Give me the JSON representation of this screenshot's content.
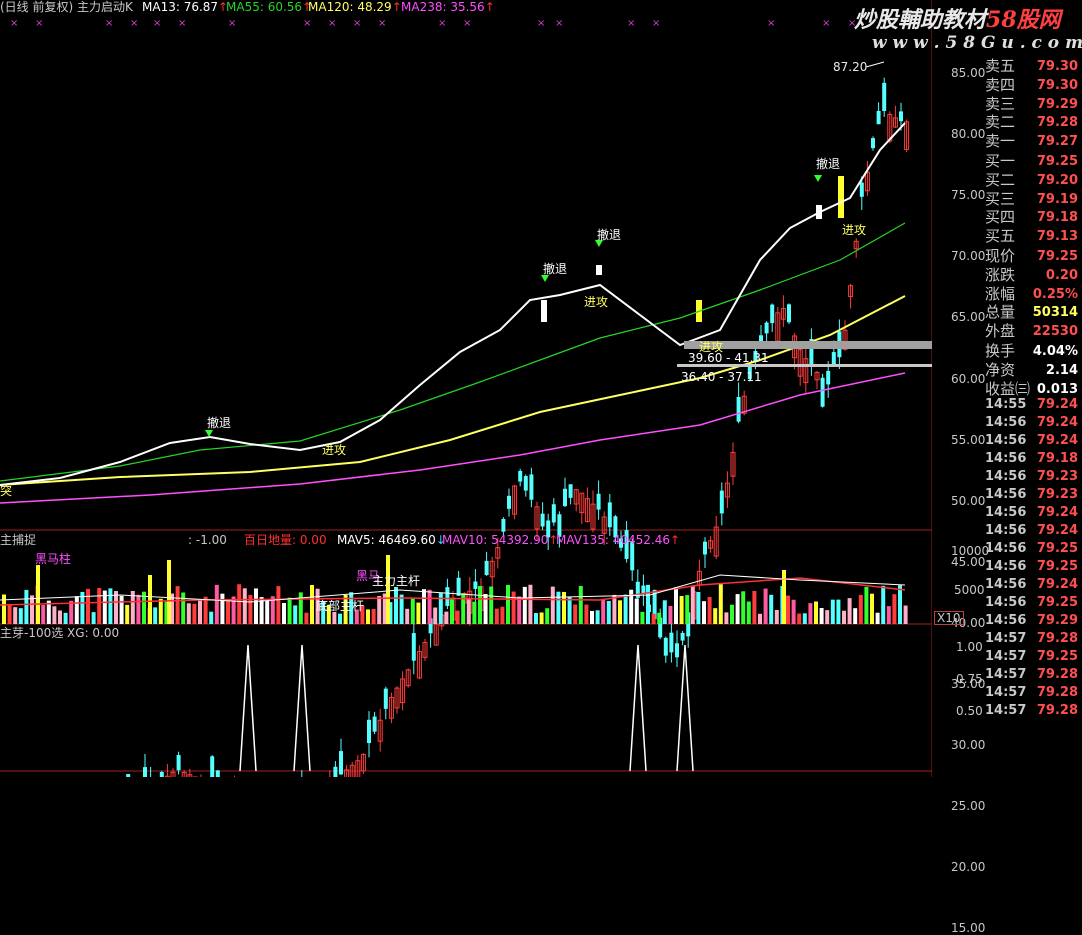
{
  "header": {
    "title": "(日线 前复权) 主力启动K",
    "ma13": {
      "label": "MA13: 76.87",
      "color": "#ffffff"
    },
    "ma55": {
      "label": "MA55: 60.56",
      "color": "#27d327"
    },
    "ma120": {
      "label": "MA120: 48.29",
      "color": "#ffff60"
    },
    "ma238": {
      "label": "MA238: 35.56",
      "color": "#ff50ff"
    },
    "arrow": "↑"
  },
  "brand": {
    "name": "炒股輔助教材",
    "site": "58股网",
    "url": "w w w . 5 8 G u . c o m"
  },
  "price_axis": [
    "85.00",
    "80.00",
    "75.00",
    "70.00",
    "65.00",
    "60.00",
    "55.00",
    "50.00",
    "45.00",
    "40.00",
    "35.00",
    "30.00",
    "25.00",
    "20.00",
    "15.00"
  ],
  "annotations": {
    "high": "87.20",
    "retreat": "撤退",
    "attack": "进攻",
    "range1": "39.60 - 41.31",
    "range2": "36.40 - 37.11",
    "left_edge": "突"
  },
  "volume_panel": {
    "title": "主捕捉",
    "v1": ": -1.00",
    "v2": "百日地量: 0.00",
    "mav5": "MAV5: 46469.60",
    "mav5_arrow": "↓",
    "mav10": "MAV10: 54392.90",
    "mav10_arrow": "↑",
    "mav135": "MAV135: 40452.46",
    "mav135_arrow": "↑",
    "tag_black_horse": "黑马柱",
    "tag_black_horse2": "黑马",
    "tag_main_force": "主力主杆",
    "tag_bottom": "底部主杆",
    "axis": [
      "10000",
      "5000"
    ],
    "unit": "X10"
  },
  "signal_panel": {
    "title": "主芽-100选  XG: 0.00",
    "axis": [
      "1.00",
      "0.75",
      "0.50"
    ]
  },
  "quote_panel": {
    "rows": [
      {
        "label": "卖五",
        "value": "79.30",
        "color": "#ff5050"
      },
      {
        "label": "卖四",
        "value": "79.30",
        "color": "#ff5050"
      },
      {
        "label": "卖三",
        "value": "79.29",
        "color": "#ff5050"
      },
      {
        "label": "卖二",
        "value": "79.28",
        "color": "#ff5050"
      },
      {
        "label": "卖一",
        "value": "79.27",
        "color": "#ff5050"
      },
      {
        "label": "买一",
        "value": "79.25",
        "color": "#ff5050"
      },
      {
        "label": "买二",
        "value": "79.20",
        "color": "#ff5050"
      },
      {
        "label": "买三",
        "value": "79.19",
        "color": "#ff5050"
      },
      {
        "label": "买四",
        "value": "79.18",
        "color": "#ff5050"
      },
      {
        "label": "买五",
        "value": "79.13",
        "color": "#ff5050"
      },
      {
        "label": "现价",
        "value": "79.25",
        "color": "#ff5050"
      },
      {
        "label": "涨跌",
        "value": "0.20",
        "color": "#ff5050"
      },
      {
        "label": "涨幅",
        "value": "0.25%",
        "color": "#ff5050"
      },
      {
        "label": "总量",
        "value": "50314",
        "color": "#ffff60"
      },
      {
        "label": "外盘",
        "value": "22530",
        "color": "#ff5050"
      },
      {
        "label": "换手",
        "value": "4.04%",
        "color": "#ffffff"
      },
      {
        "label": "净资",
        "value": "2.14",
        "color": "#ffffff"
      },
      {
        "label": "收益㈢",
        "value": "0.013",
        "color": "#ffffff"
      }
    ],
    "ticks": [
      {
        "time": "14:55",
        "price": "79.24"
      },
      {
        "time": "14:56",
        "price": "79.24"
      },
      {
        "time": "14:56",
        "price": "79.24"
      },
      {
        "time": "14:56",
        "price": "79.18"
      },
      {
        "time": "14:56",
        "price": "79.23"
      },
      {
        "time": "14:56",
        "price": "79.23"
      },
      {
        "time": "14:56",
        "price": "79.24"
      },
      {
        "time": "14:56",
        "price": "79.24"
      },
      {
        "time": "14:56",
        "price": "79.25"
      },
      {
        "time": "14:56",
        "price": "79.25"
      },
      {
        "time": "14:56",
        "price": "79.24"
      },
      {
        "time": "14:56",
        "price": "79.25"
      },
      {
        "time": "14:56",
        "price": "79.29"
      },
      {
        "time": "14:57",
        "price": "79.28"
      },
      {
        "time": "14:57",
        "price": "79.25"
      },
      {
        "time": "14:57",
        "price": "79.28"
      },
      {
        "time": "14:57",
        "price": "79.28"
      },
      {
        "time": "14:57",
        "price": "79.28"
      }
    ]
  }
}
